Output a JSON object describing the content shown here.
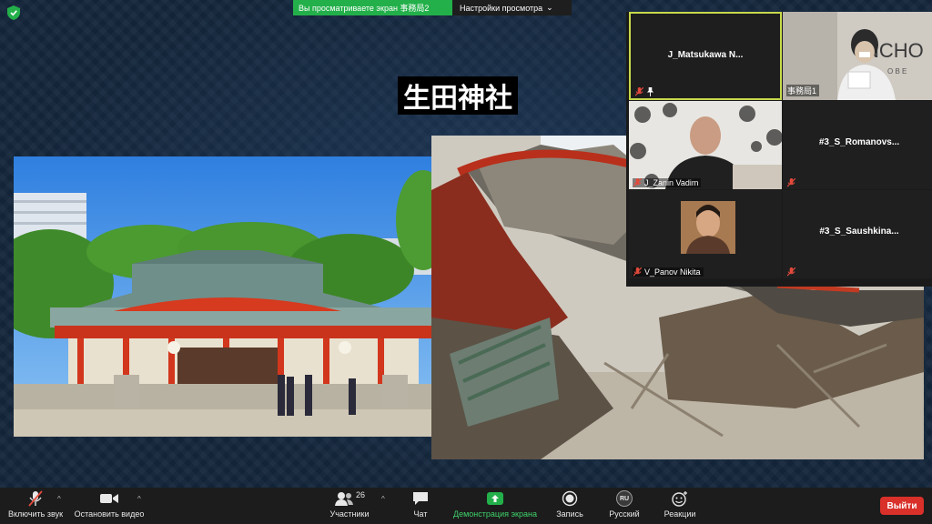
{
  "share_banner": {
    "viewing_text": "Вы  просматриваете  экран  事務局2",
    "settings_label": "Настройки просмотра",
    "settings_caret": "⌄"
  },
  "slide": {
    "title": "生田神社"
  },
  "gallery": {
    "tiles": [
      {
        "name": "J_Matsukawa  N...",
        "tag": ""
      },
      {
        "name": "",
        "tag": "事務局1"
      },
      {
        "name": "",
        "tag": "J_Zanin Vadim"
      },
      {
        "name": "#3_S_Romanovs...",
        "tag": ""
      },
      {
        "name": "",
        "tag": "V_Panov Nikita"
      },
      {
        "name": "#3_S_Saushkina...",
        "tag": ""
      }
    ]
  },
  "toolbar": {
    "mute_label": "Включить звук",
    "video_label": "Остановить видео",
    "participants_label": "Участники",
    "participants_count": "26",
    "chat_label": "Чат",
    "share_label": "Демонстрация экрана",
    "record_label": "Запись",
    "language_label": "Русский",
    "language_code": "RU",
    "reactions_label": "Реакции",
    "leave_label": "Выйти",
    "caret": "^"
  },
  "colors": {
    "share_green": "#23b04a",
    "leave_red": "#d9302a",
    "active_speaker_border": "#c7d94a",
    "toolbar_bg": "#1c1c1c"
  }
}
